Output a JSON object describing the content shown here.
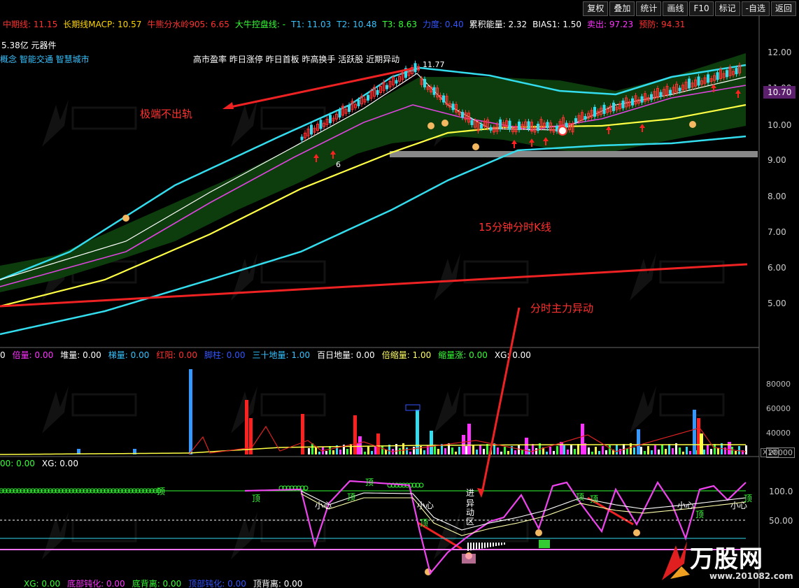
{
  "toolbar": [
    "复权",
    "叠加",
    "统计",
    "画线",
    "F10",
    "标记",
    "-自选",
    "返回"
  ],
  "indicators_row1": [
    {
      "label": "中期线: 11.15",
      "color": "#ff3030"
    },
    {
      "label": "长期线MACP: 10.57",
      "color": "#ffd700"
    },
    {
      "label": "牛熊分水岭905: 6.65",
      "color": "#ff3030"
    },
    {
      "label": "大牛控盘线: -",
      "color": "#33ff33"
    },
    {
      "label": "T1: 11.03",
      "color": "#33c3ff"
    },
    {
      "label": "T2: 10.48",
      "color": "#33c3ff"
    },
    {
      "label": "T3: 8.63",
      "color": "#33ff33"
    },
    {
      "label": "力度: 0.40",
      "color": "#3355ff"
    },
    {
      "label": "累积能量: 2.32",
      "color": "#ffffff"
    },
    {
      "label": "BIAS1: 1.50",
      "color": "#ffffff"
    },
    {
      "label": "卖出: 97.23",
      "color": "#ff33ff"
    },
    {
      "label": "预防: 94.31",
      "color": "#ff3030"
    }
  ],
  "market_cap": "5.38亿 元器件",
  "concepts": "概念 智能交通 智慧城市",
  "tags": "高市盈率 昨日涨停 昨日首板 昨高换手 活跃股 近期异动",
  "price_axis": [
    "12.00",
    "11.00",
    "10.00",
    "9.00",
    "8.00",
    "7.00",
    "6.00",
    "5.00"
  ],
  "current_price": "10.70",
  "peak_label": "11.77",
  "chart_marker": "6",
  "annotations": {
    "extreme": "极端不出轨",
    "kline": "15分钟分时K线",
    "main_force": "分时主力异动"
  },
  "volume_row": [
    {
      "label": "0",
      "color": "#ffffff"
    },
    {
      "label": "倍量: 0.00",
      "color": "#ff33ff"
    },
    {
      "label": "堆量: 0.00",
      "color": "#ffffff"
    },
    {
      "label": "梯量: 0.00",
      "color": "#33c3ff"
    },
    {
      "label": "红阳: 0.00",
      "color": "#ff3030"
    },
    {
      "label": "脚柱: 0.00",
      "color": "#3355ff"
    },
    {
      "label": "三十地量: 1.00",
      "color": "#33c3ff"
    },
    {
      "label": "百日地量: 0.00",
      "color": "#ffffff"
    },
    {
      "label": "倍缩量: 1.00",
      "color": "#ffff66"
    },
    {
      "label": "缩量涨: 0.00",
      "color": "#33ff33"
    },
    {
      "label": "XG: 0.00",
      "color": "#ffffff"
    }
  ],
  "volume_axis": [
    "80000",
    "60000",
    "40000",
    "20000"
  ],
  "volume_unit": "X10",
  "osc_row": [
    {
      "label": "00: 0.00",
      "color": "#33ff33"
    },
    {
      "label": "XG: 0.00",
      "color": "#ffffff"
    }
  ],
  "osc_axis": [
    "100.0",
    "50.00"
  ],
  "osc_texts": {
    "top": "顶",
    "careful": "小心",
    "enter": "进",
    "anomaly": "异动区"
  },
  "bottom_row": [
    {
      "label": "XG: 0.00",
      "color": "#33ff33"
    },
    {
      "label": "底部钝化: 0.00",
      "color": "#ff33ff"
    },
    {
      "label": "底背离: 0.00",
      "color": "#33ff33"
    },
    {
      "label": "顶部钝化: 0.00",
      "color": "#3355ff"
    },
    {
      "label": "顶背离: 0.00",
      "color": "#ffffff"
    }
  ],
  "watermark": {
    "title": "万股网",
    "url": "www.201082.com"
  }
}
